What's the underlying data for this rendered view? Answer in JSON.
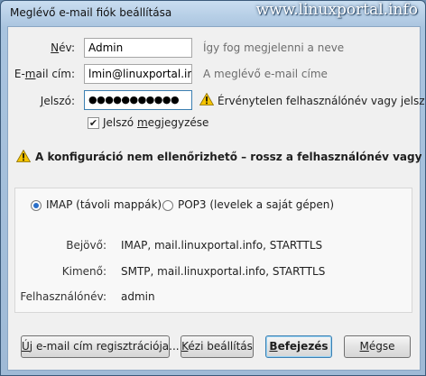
{
  "window": {
    "title": "Meglévő e-mail fiók beállítása",
    "watermark": "www.linuxportal.info"
  },
  "form": {
    "name": {
      "label_pre": "",
      "label_acc": "N",
      "label_post": "év:",
      "value": "Admin",
      "hint": "Így fog megjelenni a neve"
    },
    "email": {
      "label_pre": "E-",
      "label_acc": "m",
      "label_post": "ail cím:",
      "value": "lmin@linuxportal.info",
      "hint": "A meglévő e-mail címe"
    },
    "password": {
      "label_pre": "",
      "label_acc": "J",
      "label_post": "elszó:",
      "value": "●●●●●●●●●●●",
      "warning": "Érvénytelen felhasználónév vagy jelszó"
    },
    "remember": {
      "checked": true,
      "label_pre": "Jelszó ",
      "label_acc": "m",
      "label_post": "egjegyzése"
    }
  },
  "config_warning": "A konfiguráció nem ellenőrizhető – rossz a felhasználónév vagy a jelszó?",
  "protocol": {
    "imap_label": "IMAP (távoli mappák)",
    "pop3_label": "POP3 (levelek a saját gépen)",
    "selected": "imap"
  },
  "details": {
    "incoming_label": "Bejövő:",
    "incoming_value": "IMAP, mail.linuxportal.info, STARTTLS",
    "outgoing_label": "Kimenő:",
    "outgoing_value": "SMTP, mail.linuxportal.info, STARTTLS",
    "username_label": "Felhasználónév:",
    "username_value": "admin"
  },
  "buttons": {
    "register": {
      "acc": "Ú",
      "rest": "j e-mail cím regisztrációja..."
    },
    "manual": {
      "acc": "K",
      "rest": "ézi beállítás"
    },
    "create": {
      "acc": "B",
      "rest": "efejezés"
    },
    "cancel": {
      "pre": "",
      "acc": "M",
      "rest": "égse"
    }
  },
  "colors": {
    "accent": "#2a6fc9",
    "warning": "#f5c400"
  }
}
